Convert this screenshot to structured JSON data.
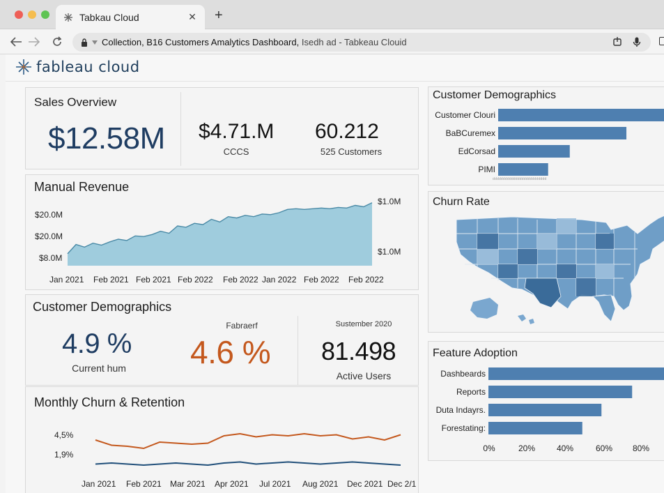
{
  "browser": {
    "tab_title": "Tabkau Cloud",
    "tab_close": "✕",
    "new_tab": "+",
    "url_main": "Collection, B16 Customers Amalytics Dashboard,",
    "url_rest": " Isedh ad - Tabkeau Clouid"
  },
  "logo": {
    "text": "fableau cloud"
  },
  "sales_overview": {
    "title": "Sales Overview",
    "primary_value": "$12.58M",
    "kpi2_value": "$4.71.M",
    "kpi2_label": "CCCS",
    "kpi3_value": "60.212",
    "kpi3_label": "525 Customers"
  },
  "manual_revenue": {
    "title": "Manual Revenue",
    "y_left": [
      "$20.0M",
      "$20.0M",
      "$8.0M"
    ],
    "y_right": [
      "$1.0M",
      "$1.0M"
    ],
    "x_labels": [
      "Jan 2021",
      "Feb 2021",
      "Feb 2021",
      "Feb 2022",
      "Feb 2022",
      "Jan 2022",
      "Feb 2022",
      "Feb 2022"
    ]
  },
  "customer_demographics_kpis": {
    "title": "Customer Demographics",
    "kpi1_value": "4.9 %",
    "kpi1_label": "Current hum",
    "kpi2_header": "Fabraerf",
    "kpi2_value": "4.6 %",
    "kpi3_header": "Sustember 2020",
    "kpi3_value": "81.498",
    "kpi3_label": "Active Users",
    "kpi_colors": {
      "kpi1": "#1f3d62",
      "kpi2": "#c4581d",
      "kpi3": "#111111"
    }
  },
  "monthly_churn": {
    "title": "Monthly Churn & Retention",
    "y_labels": [
      "4,5%",
      "1,9%"
    ],
    "x_labels": [
      "Jan 2021",
      "Feb 2021",
      "Mar 2021",
      "Apr 2021",
      "Jul 2021",
      "Aug 2021",
      "Dec 2021",
      "Dec 2/1"
    ]
  },
  "customer_demographics_bars": {
    "title": "Customer Demographics",
    "caption": "dddddddddddddddddddddddddd"
  },
  "churn_rate": {
    "title": "Churn Rate"
  },
  "feature_adoption": {
    "title": "Feature Adoption",
    "x_labels": [
      "0%",
      "20%",
      "40%",
      "60%",
      "80%"
    ]
  },
  "chart_data": [
    {
      "type": "area",
      "title": "Manual Revenue",
      "x": [
        "Jan 2021",
        "Feb 2021",
        "Feb 2021",
        "Feb 2022",
        "Feb 2022",
        "Jan 2022",
        "Feb 2022",
        "Feb 2022"
      ],
      "y_relative": [
        0.18,
        0.32,
        0.28,
        0.34,
        0.31,
        0.36,
        0.4,
        0.38,
        0.45,
        0.44,
        0.47,
        0.52,
        0.49,
        0.6,
        0.58,
        0.64,
        0.62,
        0.7,
        0.66,
        0.74,
        0.72,
        0.76,
        0.74,
        0.78,
        0.77,
        0.8,
        0.85,
        0.86,
        0.85,
        0.86,
        0.87,
        0.86,
        0.88,
        0.87,
        0.91,
        0.89,
        0.95
      ],
      "color": "#9fccdd",
      "line_color": "#4a8aa6"
    },
    {
      "type": "line",
      "title": "Monthly Churn & Retention",
      "x": [
        "Jan 2021",
        "Feb 2021",
        "Mar 2021",
        "Apr 2021",
        "Jul 2021",
        "Aug 2021",
        "Dec 2021",
        "Dec 2/1"
      ],
      "series": [
        {
          "color": "#c4581d",
          "values": [
            4.1,
            3.6,
            3.5,
            3.3,
            3.9,
            3.8,
            3.7,
            3.8,
            4.5,
            4.7,
            4.4,
            4.6,
            4.5,
            4.7,
            4.5,
            4.6,
            4.2,
            4.4,
            4.1,
            4.6
          ]
        },
        {
          "color": "#1f4e79",
          "values": [
            1.8,
            1.9,
            1.8,
            1.7,
            1.8,
            1.9,
            1.8,
            1.7,
            1.9,
            2.0,
            1.8,
            1.9,
            2.0,
            1.9,
            1.8,
            1.9,
            2.0,
            1.9,
            1.8,
            1.7
          ]
        }
      ]
    },
    {
      "type": "bar",
      "orientation": "horizontal",
      "title": "Customer Demographics",
      "categories": [
        "Customer Clouri",
        "BaBCuremex",
        "EdCorsad",
        "PIMI"
      ],
      "values": [
        1.0,
        0.77,
        0.43,
        0.3
      ],
      "color": "#4e7fb0"
    },
    {
      "type": "bar",
      "orientation": "horizontal",
      "title": "Feature Adoption",
      "categories": [
        "Dashbeards",
        "Reports",
        "Duta Indayrs.",
        "Forestating:"
      ],
      "values": [
        92,
        75,
        59,
        49
      ],
      "xlim": [
        0,
        92
      ],
      "x_ticks": [
        "0%",
        "20%",
        "40%",
        "60%",
        "80%"
      ],
      "color": "#4e7fb0"
    }
  ]
}
